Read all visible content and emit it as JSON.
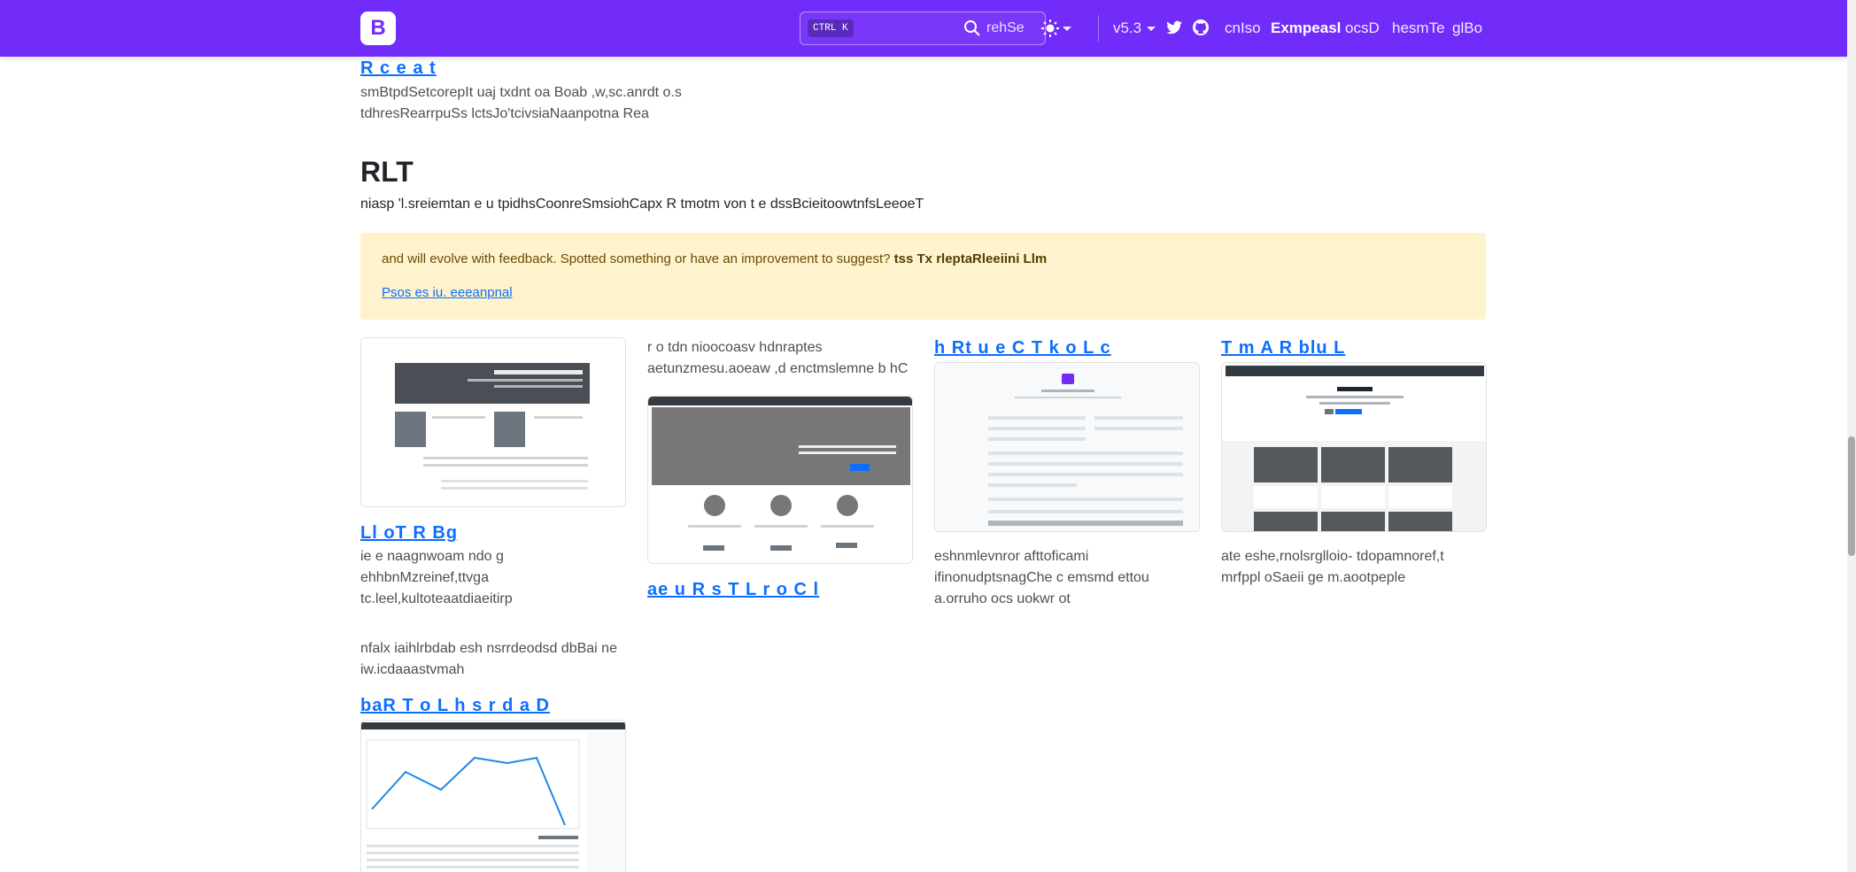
{
  "navbar": {
    "logo_letter": "B",
    "search": {
      "shortcut": "CTRL K",
      "label": "rehSe"
    },
    "version": "v5.3",
    "links": [
      "cnIso",
      "Exmpeasl",
      "ocsD",
      "hesmTe",
      "glBo"
    ]
  },
  "top_example": {
    "title": "R c e a t",
    "desc_lines": [
      "smBtpdSetcorepIt uaj txdnt oa Boab ,w,sc.anrdt o.s",
      "tdhresRearrpuSs lctsJo'tcivsiaNaanpotna Rea"
    ]
  },
  "rtl": {
    "heading": "RLT",
    "lead": "niasp 'l.sreiemtan e u tpidhsCoonreSmsiohCapx R tmotm von t e dssBcieitoowtnfsLeeoeT"
  },
  "alert": {
    "text": "and will evolve with feedback. Spotted something or have an improvement to suggest?",
    "bold": "tss Tx rleptaRleeiini Llm",
    "link": "Psos es iu. eeeanpnal"
  },
  "examples": {
    "album": {
      "title": "Ll oT R Bg",
      "desc": [
        "ie e naagnwoam ndo g",
        "ehhbnMzreinef,ttvga",
        "tc.leel,kultoteaatdiaeitirp"
      ]
    },
    "carousel": {
      "title": "ae u R s T L r o C l",
      "desc": [
        "r o tdn nioocoasv hdnraptes",
        "aetunzmesu.aoeaw ,d enctmslemne b hC"
      ]
    },
    "checkout": {
      "title": "h Rt u e C T k o L c",
      "desc": [
        "eshnmlevnror afttoficami",
        "ifinonudptsnagChe c emsmd ettou",
        "a.orruho ocs uokwr ot"
      ]
    },
    "album_rtl": {
      "title": "T m A R blu L",
      "desc": [
        "ate eshe,rnolsrglloio- tdopamnoref,t",
        "mrfppl oSaeii ge m.aootpeple"
      ]
    },
    "dashboard": {
      "title": "baR T o L h s r d a D",
      "desc": [
        "nfalx iaihlrbdab esh nsrrdeodsd dbBai ne",
        "iw.icdaaastvmah"
      ]
    }
  },
  "colors": {
    "brand": "#712cf9",
    "link": "#0d6efd",
    "alert_bg": "#fff3cd"
  },
  "icons": [
    "search-icon",
    "sun-icon",
    "twitter-icon",
    "github-icon",
    "chevron-down-icon"
  ]
}
